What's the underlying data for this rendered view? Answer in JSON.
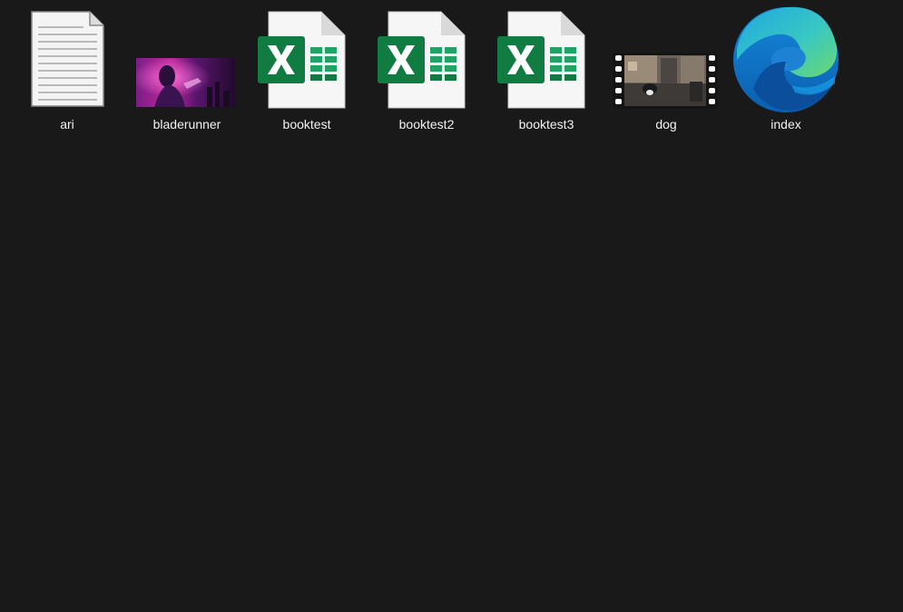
{
  "window": {
    "title": ""
  },
  "files": [
    {
      "name": "ari",
      "type": "text",
      "icon": "text-document-icon"
    },
    {
      "name": "bladerunner",
      "type": "image",
      "icon": "image-thumbnail-icon"
    },
    {
      "name": "booktest",
      "type": "excel",
      "icon": "excel-icon"
    },
    {
      "name": "booktest2",
      "type": "excel",
      "icon": "excel-icon"
    },
    {
      "name": "booktest3",
      "type": "excel",
      "icon": "excel-icon"
    },
    {
      "name": "dog",
      "type": "video",
      "icon": "video-thumbnail-icon"
    },
    {
      "name": "index",
      "type": "html",
      "icon": "edge-icon"
    }
  ],
  "colors": {
    "background": "#191919",
    "label": "#f2f2f2",
    "excel_green": "#107C41",
    "edge_blue": "#0C59A4",
    "edge_green": "#50E6FF"
  }
}
